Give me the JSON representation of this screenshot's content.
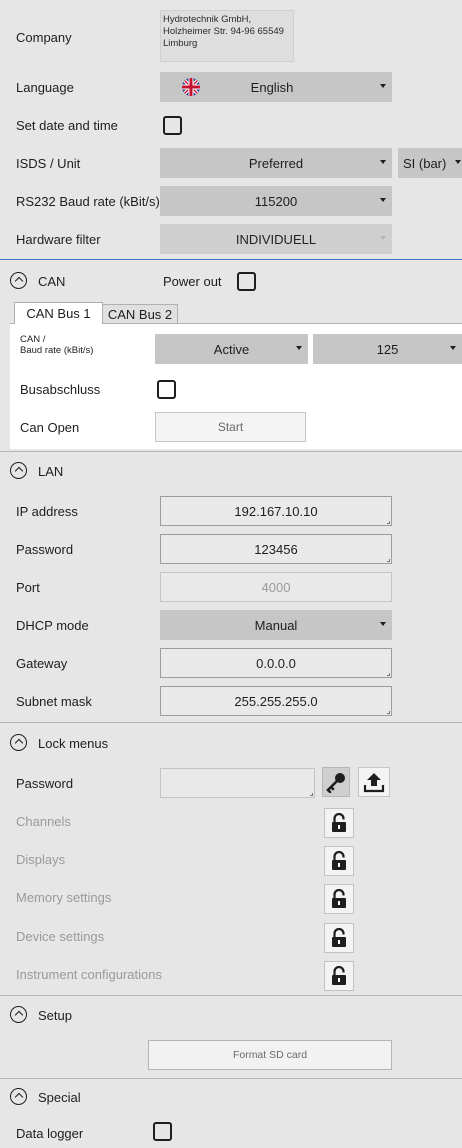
{
  "general": {
    "company_label": "Company",
    "company_value": "Hydrotechnik GmbH,\nHolzheimer Str. 94-96 65549\nLimburg",
    "language_label": "Language",
    "language_value": "English",
    "datetime_label": "Set date and time",
    "isds_label": "ISDS / Unit",
    "isds_value": "Preferred",
    "unit_value": "SI (bar)",
    "baud_label": "RS232 Baud rate (kBit/s)",
    "baud_value": "115200",
    "hwfilter_label": "Hardware filter",
    "hwfilter_value": "INDIVIDUELL"
  },
  "can": {
    "title": "CAN",
    "power_out_label": "Power out",
    "tabs": [
      "CAN Bus 1",
      "CAN Bus 2"
    ],
    "baud_label_line1": "CAN /",
    "baud_label_line2": "Baud rate (kBit/s)",
    "mode_value": "Active",
    "rate_value": "125",
    "busabschluss_label": "Busabschluss",
    "canopen_label": "Can Open",
    "start_label": "Start"
  },
  "lan": {
    "title": "LAN",
    "ip_label": "IP address",
    "ip_value": "192.167.10.10",
    "password_label": "Password",
    "password_value": "123456",
    "port_label": "Port",
    "port_value": "4000",
    "dhcp_label": "DHCP mode",
    "dhcp_value": "Manual",
    "gateway_label": "Gateway",
    "gateway_value": "0.0.0.0",
    "subnet_label": "Subnet mask",
    "subnet_value": "255.255.255.0"
  },
  "lock": {
    "title": "Lock menus",
    "password_label": "Password",
    "password_value": "",
    "items": [
      "Channels",
      "Displays",
      "Memory settings",
      "Device settings",
      "Instrument configurations"
    ]
  },
  "setup": {
    "title": "Setup",
    "format_label": "Format SD card"
  },
  "special": {
    "title": "Special",
    "datalogger_label": "Data logger"
  },
  "colors": {
    "background": "#e6e6e6",
    "dropdown": "#c6c6c6",
    "accent_line": "#3c78c8"
  }
}
